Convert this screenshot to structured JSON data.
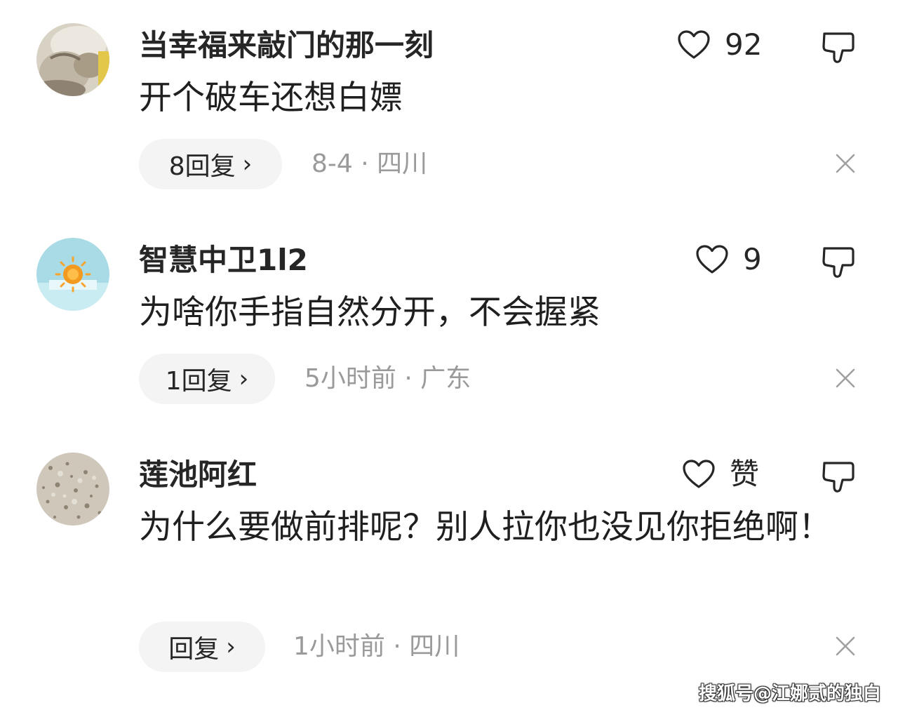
{
  "comments": [
    {
      "username": "当幸福来敲门的那一刻",
      "text": "开个破车还想白嫖",
      "likes": "92",
      "reply_label": "8回复",
      "meta": "8-4 · 四川",
      "avatar_icon": "cat-photo-avatar"
    },
    {
      "username": "智慧中卫1l2",
      "text": "为啥你手指自然分开，不会握紧",
      "likes": "9",
      "reply_label": "1回复",
      "meta": "5小时前 · 广东",
      "avatar_icon": "sun-photo-avatar"
    },
    {
      "username": "莲池阿红",
      "text": "为什么要做前排呢？别人拉你也没见你拒绝啊！",
      "likes": "赞",
      "reply_label": "回复",
      "meta": "1小时前 · 四川",
      "avatar_icon": "texture-photo-avatar"
    }
  ],
  "reply_chevron": "›",
  "watermark": "搜狐号@江娜贰的独白",
  "colors": {
    "text_primary": "#1f1f1f",
    "text_meta": "#9a9a9a",
    "pill_background": "#f4f4f4"
  }
}
